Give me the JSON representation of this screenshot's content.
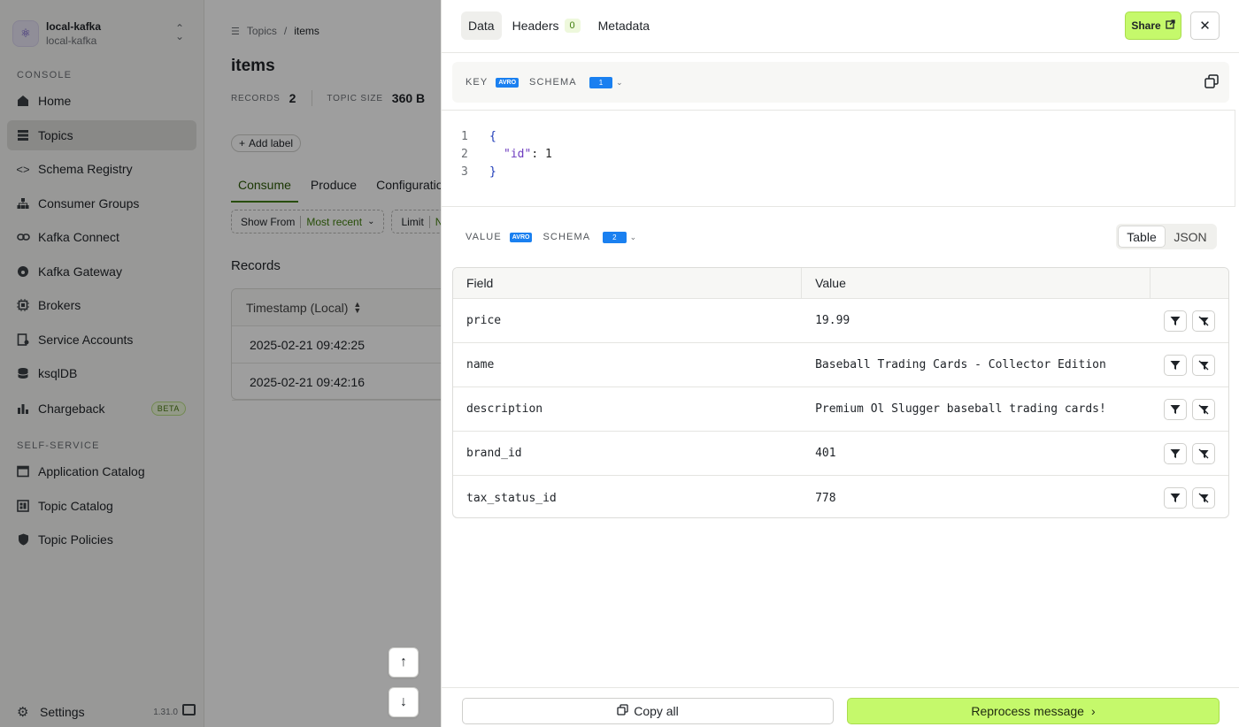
{
  "sidebar": {
    "cluster": {
      "name": "local-kafka",
      "subname": "local-kafka"
    },
    "console_label": "CONSOLE",
    "items": [
      {
        "label": "Home",
        "icon": "home-icon"
      },
      {
        "label": "Topics",
        "icon": "topics-icon",
        "active": true
      },
      {
        "label": "Schema Registry",
        "icon": "code-icon"
      },
      {
        "label": "Consumer Groups",
        "icon": "hierarchy-icon"
      },
      {
        "label": "Kafka Connect",
        "icon": "link-icon"
      },
      {
        "label": "Kafka Gateway",
        "icon": "gateway-icon"
      },
      {
        "label": "Brokers",
        "icon": "cpu-icon"
      },
      {
        "label": "Service Accounts",
        "icon": "document-user-icon"
      },
      {
        "label": "ksqlDB",
        "icon": "database-icon"
      },
      {
        "label": "Chargeback",
        "icon": "bar-chart-icon",
        "badge": "BETA"
      }
    ],
    "self_service_label": "SELF-SERVICE",
    "self_service_items": [
      {
        "label": "Application Catalog",
        "icon": "window-icon"
      },
      {
        "label": "Topic Catalog",
        "icon": "grid-icon"
      },
      {
        "label": "Topic Policies",
        "icon": "shield-icon"
      }
    ],
    "settings_label": "Settings",
    "version": "1.31.0"
  },
  "main": {
    "breadcrumb": {
      "parent": "Topics",
      "separator": "/",
      "current": "items"
    },
    "title": "items",
    "stats": {
      "records_label": "RECORDS",
      "records_value": "2",
      "size_label": "TOPIC SIZE",
      "size_value": "360 B"
    },
    "add_label": "Add label",
    "tabs": [
      "Consume",
      "Produce",
      "Configuration"
    ],
    "filters": {
      "show_from_label": "Show From",
      "show_from_value": "Most recent",
      "limit_label": "Limit",
      "limit_value": "N"
    },
    "records_heading": "Records",
    "records_table": {
      "column": "Timestamp (Local)",
      "rows": [
        "2025-02-21 09:42:25",
        "2025-02-21 09:42:16"
      ]
    }
  },
  "drawer": {
    "tabs": {
      "data": "Data",
      "headers": "Headers",
      "headers_count": "0",
      "metadata": "Metadata"
    },
    "share_label": "Share",
    "key": {
      "label": "KEY",
      "format": "AVRO",
      "schema_label": "SCHEMA",
      "schema_version": "1"
    },
    "key_code": [
      {
        "ln": "1",
        "text": "{"
      },
      {
        "ln": "2",
        "key": "\"id\"",
        "colon": ": ",
        "value": "1"
      },
      {
        "ln": "3",
        "text": "}"
      }
    ],
    "value": {
      "label": "VALUE",
      "format": "AVRO",
      "schema_label": "SCHEMA",
      "schema_version": "2"
    },
    "view_toggle": {
      "table": "Table",
      "json": "JSON",
      "selected": "Table"
    },
    "fields_table": {
      "headers": {
        "field": "Field",
        "value": "Value"
      },
      "rows": [
        {
          "field": "price",
          "value": "19.99"
        },
        {
          "field": "name",
          "value": "Baseball Trading Cards - Collector Edition"
        },
        {
          "field": "description",
          "value": "Premium Ol Slugger baseball trading cards!"
        },
        {
          "field": "brand_id",
          "value": "401"
        },
        {
          "field": "tax_status_id",
          "value": "778"
        }
      ]
    },
    "copy_all_label": "Copy all",
    "reprocess_label": "Reprocess message"
  },
  "colors": {
    "accent": "#c5f96b",
    "avro_badge": "#1a80f0",
    "active_tab": "#3f7d0c"
  }
}
